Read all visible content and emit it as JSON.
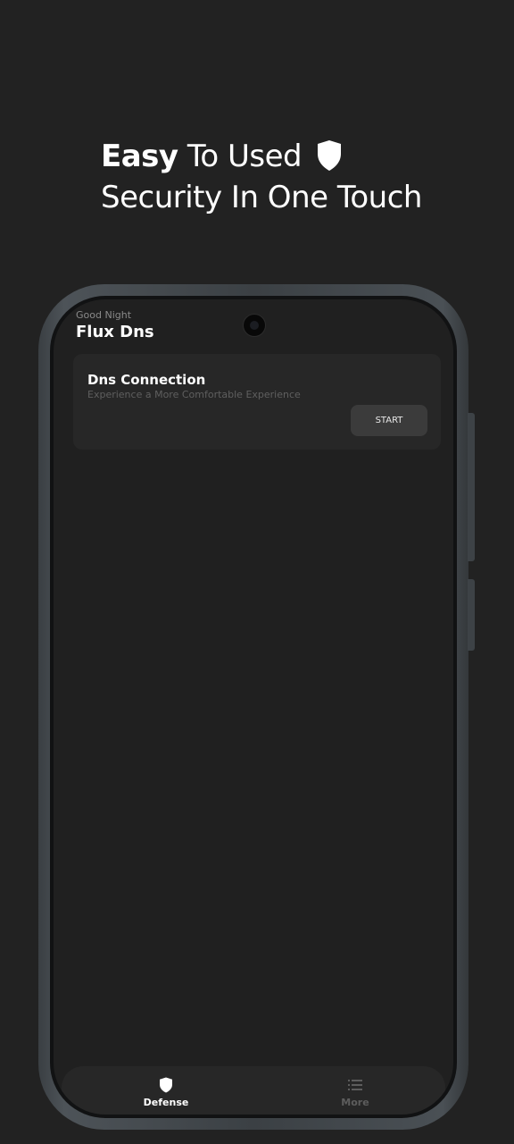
{
  "promo": {
    "line1_bold": "Easy",
    "line1_rest": " To Used",
    "line2": "Security In One Touch",
    "shield_icon": "shield-icon"
  },
  "header": {
    "greeting": "Good Night",
    "app_title": "Flux Dns"
  },
  "dns_card": {
    "title": "Dns Connection",
    "subtitle": "Experience a More Comfortable Experience",
    "button_label": "START"
  },
  "bottom_nav": {
    "items": [
      {
        "label": "Defense",
        "icon": "shield-icon",
        "active": true
      },
      {
        "label": "More",
        "icon": "list-icon",
        "active": false
      }
    ]
  },
  "colors": {
    "background": "#222222",
    "screen": "#202020",
    "card": "#272727",
    "button": "#3b3b3b",
    "text_primary": "#ffffff",
    "text_muted": "#5f5f5f"
  }
}
